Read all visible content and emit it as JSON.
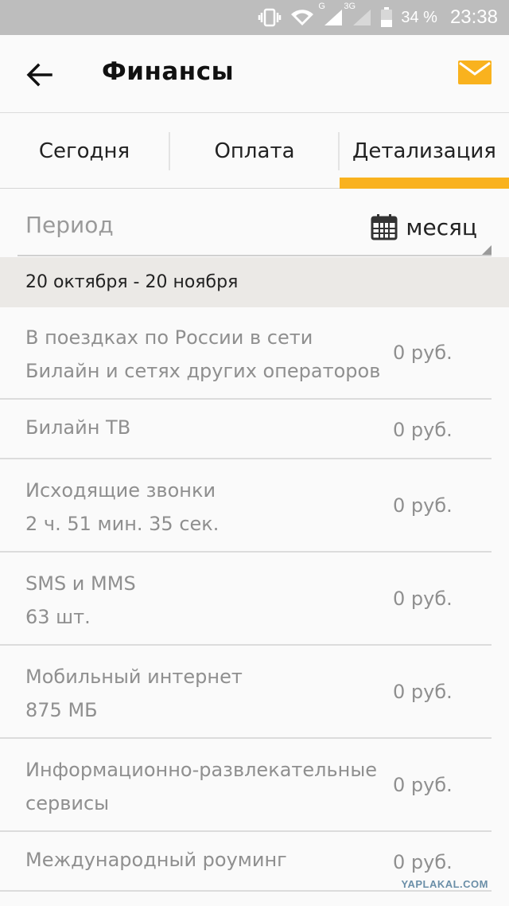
{
  "status_bar": {
    "network_g": "G",
    "network_3g": "3G",
    "battery": "34 %",
    "time": "23:38"
  },
  "app_bar": {
    "title": "Финансы",
    "back_icon": "arrow-left-icon",
    "mail_icon": "envelope-icon",
    "accent_color": "#f9b21e"
  },
  "tabs": [
    {
      "label": "Сегодня",
      "active": false
    },
    {
      "label": "Оплата",
      "active": false
    },
    {
      "label": "Детализация",
      "active": true
    }
  ],
  "period": {
    "label": "Период",
    "value": "месяц",
    "icon": "calendar-icon"
  },
  "range": "20 октября - 20 ноября",
  "items": [
    {
      "title": "В поездках по России в сети Билайн и сетях других операторов",
      "line1": "В поездках по России в сети",
      "line2": "Билайн и сетях других операторов",
      "amount": "0 руб."
    },
    {
      "title": "Билайн ТВ",
      "line1": "Билайн ТВ",
      "line2": "",
      "amount": "0 руб."
    },
    {
      "title": "Исходящие звонки",
      "line1": "Исходящие звонки",
      "line2": "2 ч. 51 мин. 35 сек.",
      "amount": "0 руб."
    },
    {
      "title": "SMS и MMS",
      "line1": "SMS и MMS",
      "line2": "63 шт.",
      "amount": "0 руб."
    },
    {
      "title": "Мобильный интернет",
      "line1": "Мобильный интернет",
      "line2": "875 МБ",
      "amount": "0 руб."
    },
    {
      "title": "Информационно-развлекательные сервисы",
      "line1": "Информационно-развлекательные",
      "line2": "сервисы",
      "amount": "0 руб."
    },
    {
      "title": "Международный роуминг",
      "line1": "Международный роуминг",
      "line2": "",
      "amount": "0 руб."
    }
  ],
  "watermark": "YAPLAKAL.COM"
}
